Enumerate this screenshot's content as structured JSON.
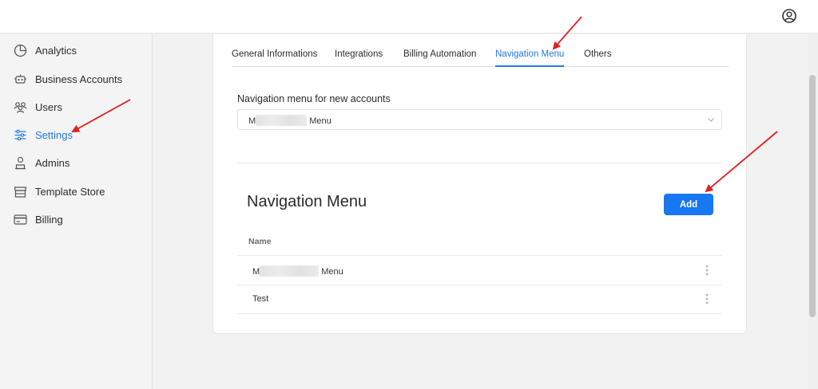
{
  "header": {
    "user_icon": "user-circle-icon"
  },
  "sidebar": {
    "items": [
      {
        "label": "Analytics",
        "icon": "analytics-icon"
      },
      {
        "label": "Business Accounts",
        "icon": "robot-icon"
      },
      {
        "label": "Users",
        "icon": "users-icon"
      },
      {
        "label": "Settings",
        "icon": "sliders-icon",
        "active": true
      },
      {
        "label": "Admins",
        "icon": "admin-icon"
      },
      {
        "label": "Template Store",
        "icon": "store-icon"
      },
      {
        "label": "Billing",
        "icon": "credit-card-icon"
      }
    ]
  },
  "tabs": [
    {
      "label": "General Informations"
    },
    {
      "label": "Integrations"
    },
    {
      "label": "Billing Automation"
    },
    {
      "label": "Navigation Menu",
      "active": true
    },
    {
      "label": "Others"
    }
  ],
  "default_menu": {
    "label": "Navigation menu for new accounts",
    "value_prefix": "M",
    "value_suffix": "Menu"
  },
  "menus_section": {
    "title": "Navigation Menu",
    "add_label": "Add",
    "column_name": "Name",
    "rows": [
      {
        "prefix": "M",
        "suffix": "Menu"
      },
      {
        "name": "Test"
      }
    ]
  },
  "colors": {
    "accent": "#1877f2",
    "active_text": "#1f7ae0",
    "annotation_arrow": "#e02020"
  }
}
